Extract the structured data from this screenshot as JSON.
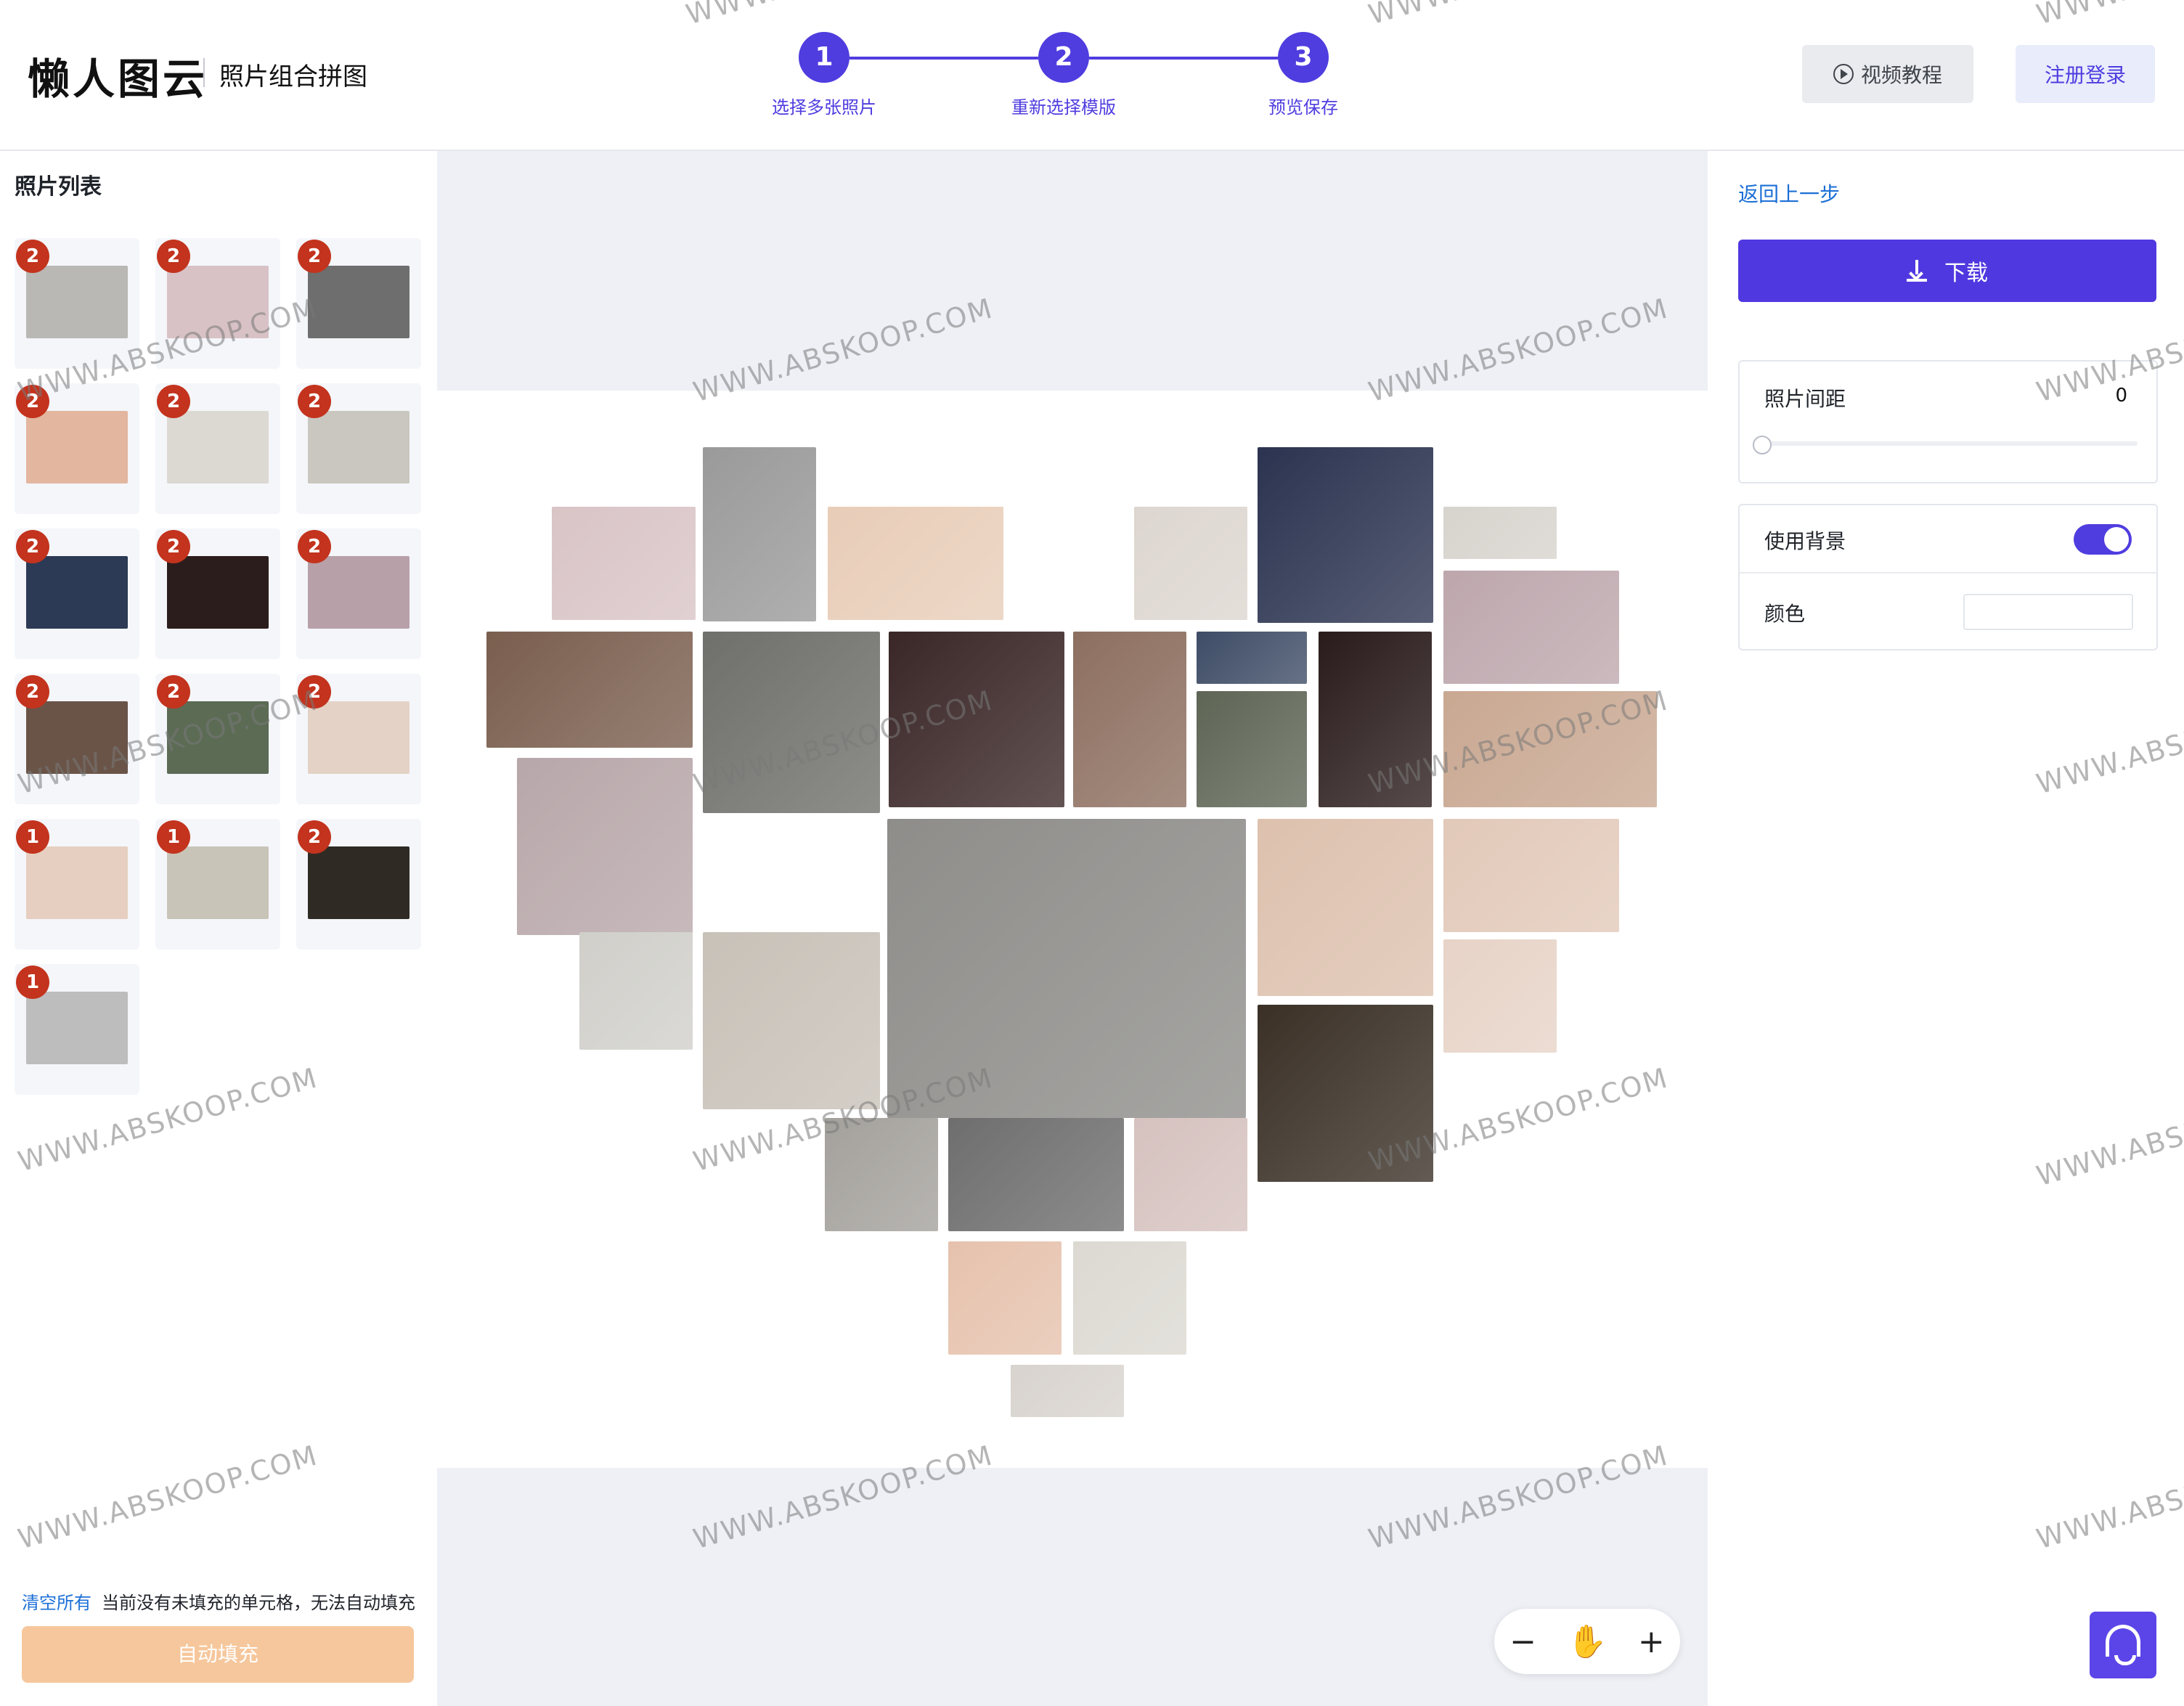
{
  "header": {
    "logo": "懒人图云",
    "subtitle": "照片组合拼图",
    "steps": [
      {
        "num": "1",
        "label": "选择多张照片"
      },
      {
        "num": "2",
        "label": "重新选择模版"
      },
      {
        "num": "3",
        "label": "预览保存"
      }
    ],
    "video_btn": "视频教程",
    "login_btn": "注册登录"
  },
  "left": {
    "title": "照片列表",
    "thumbs": [
      {
        "count": "2",
        "color": "#b9b8b4"
      },
      {
        "count": "2",
        "color": "#d8c2c6"
      },
      {
        "count": "2",
        "color": "#6e6e6e"
      },
      {
        "count": "2",
        "color": "#e3b6a0"
      },
      {
        "count": "2",
        "color": "#dcd8d2"
      },
      {
        "count": "2",
        "color": "#c9c7bf"
      },
      {
        "count": "2",
        "color": "#2d3a55"
      },
      {
        "count": "2",
        "color": "#2c1d1d"
      },
      {
        "count": "2",
        "color": "#b8a0a8"
      },
      {
        "count": "2",
        "color": "#6a5448"
      },
      {
        "count": "2",
        "color": "#5c6b54"
      },
      {
        "count": "2",
        "color": "#e4d2c6"
      },
      {
        "count": "1",
        "color": "#e6cfc0"
      },
      {
        "count": "1",
        "color": "#c9c4b8"
      },
      {
        "count": "2",
        "color": "#2f2a24"
      },
      {
        "count": "1",
        "color": "#bdbdbd"
      }
    ],
    "clear_link": "清空所有",
    "fill_status": "当前没有未填充的单元格，无法自动填充",
    "autofill_btn": "自动填充"
  },
  "canvas": {
    "photos": [
      {
        "color": "#d9c4c6"
      },
      {
        "color": "#9a9a9a"
      },
      {
        "color": "#e8cdb8"
      },
      {
        "color": "#ddd6d0"
      },
      {
        "color": "#2b3350"
      },
      {
        "color": "#d7d3cd"
      },
      {
        "color": "#7a5e4e"
      },
      {
        "color": "#6f6f6b"
      },
      {
        "color": "#3a2626"
      },
      {
        "color": "#8d6f60"
      },
      {
        "color": "#3e4c66"
      },
      {
        "color": "#5e6555"
      },
      {
        "color": "#2a1b1b"
      },
      {
        "color": "#bda7ad"
      },
      {
        "color": "#c9a892"
      },
      {
        "color": "#b8a7aa"
      },
      {
        "color": "#8e8d8a"
      },
      {
        "color": "#ddc1ae"
      },
      {
        "color": "#e2c9b9"
      },
      {
        "color": "#d0cfca"
      },
      {
        "color": "#c8c1b8"
      },
      {
        "color": "#e7d3c7"
      },
      {
        "color": "#3a3026"
      },
      {
        "color": "#a4a19c"
      },
      {
        "color": "#6e6e6e"
      },
      {
        "color": "#d6c2bf"
      },
      {
        "color": "#e6c2ad"
      },
      {
        "color": "#dcd9d2"
      },
      {
        "color": "#d8d3ce"
      }
    ]
  },
  "zoom": {
    "minus": "−",
    "plus": "+"
  },
  "right": {
    "back_link": "返回上一步",
    "download_btn": "下载",
    "spacing_label": "照片间距",
    "spacing_value": "0",
    "spacing_fraction": 0,
    "bg_label": "使用背景",
    "bg_enabled": true,
    "color_label": "颜色",
    "color_value": "#ffffff"
  },
  "watermark": "WWW.ABSKOOP.COM"
}
